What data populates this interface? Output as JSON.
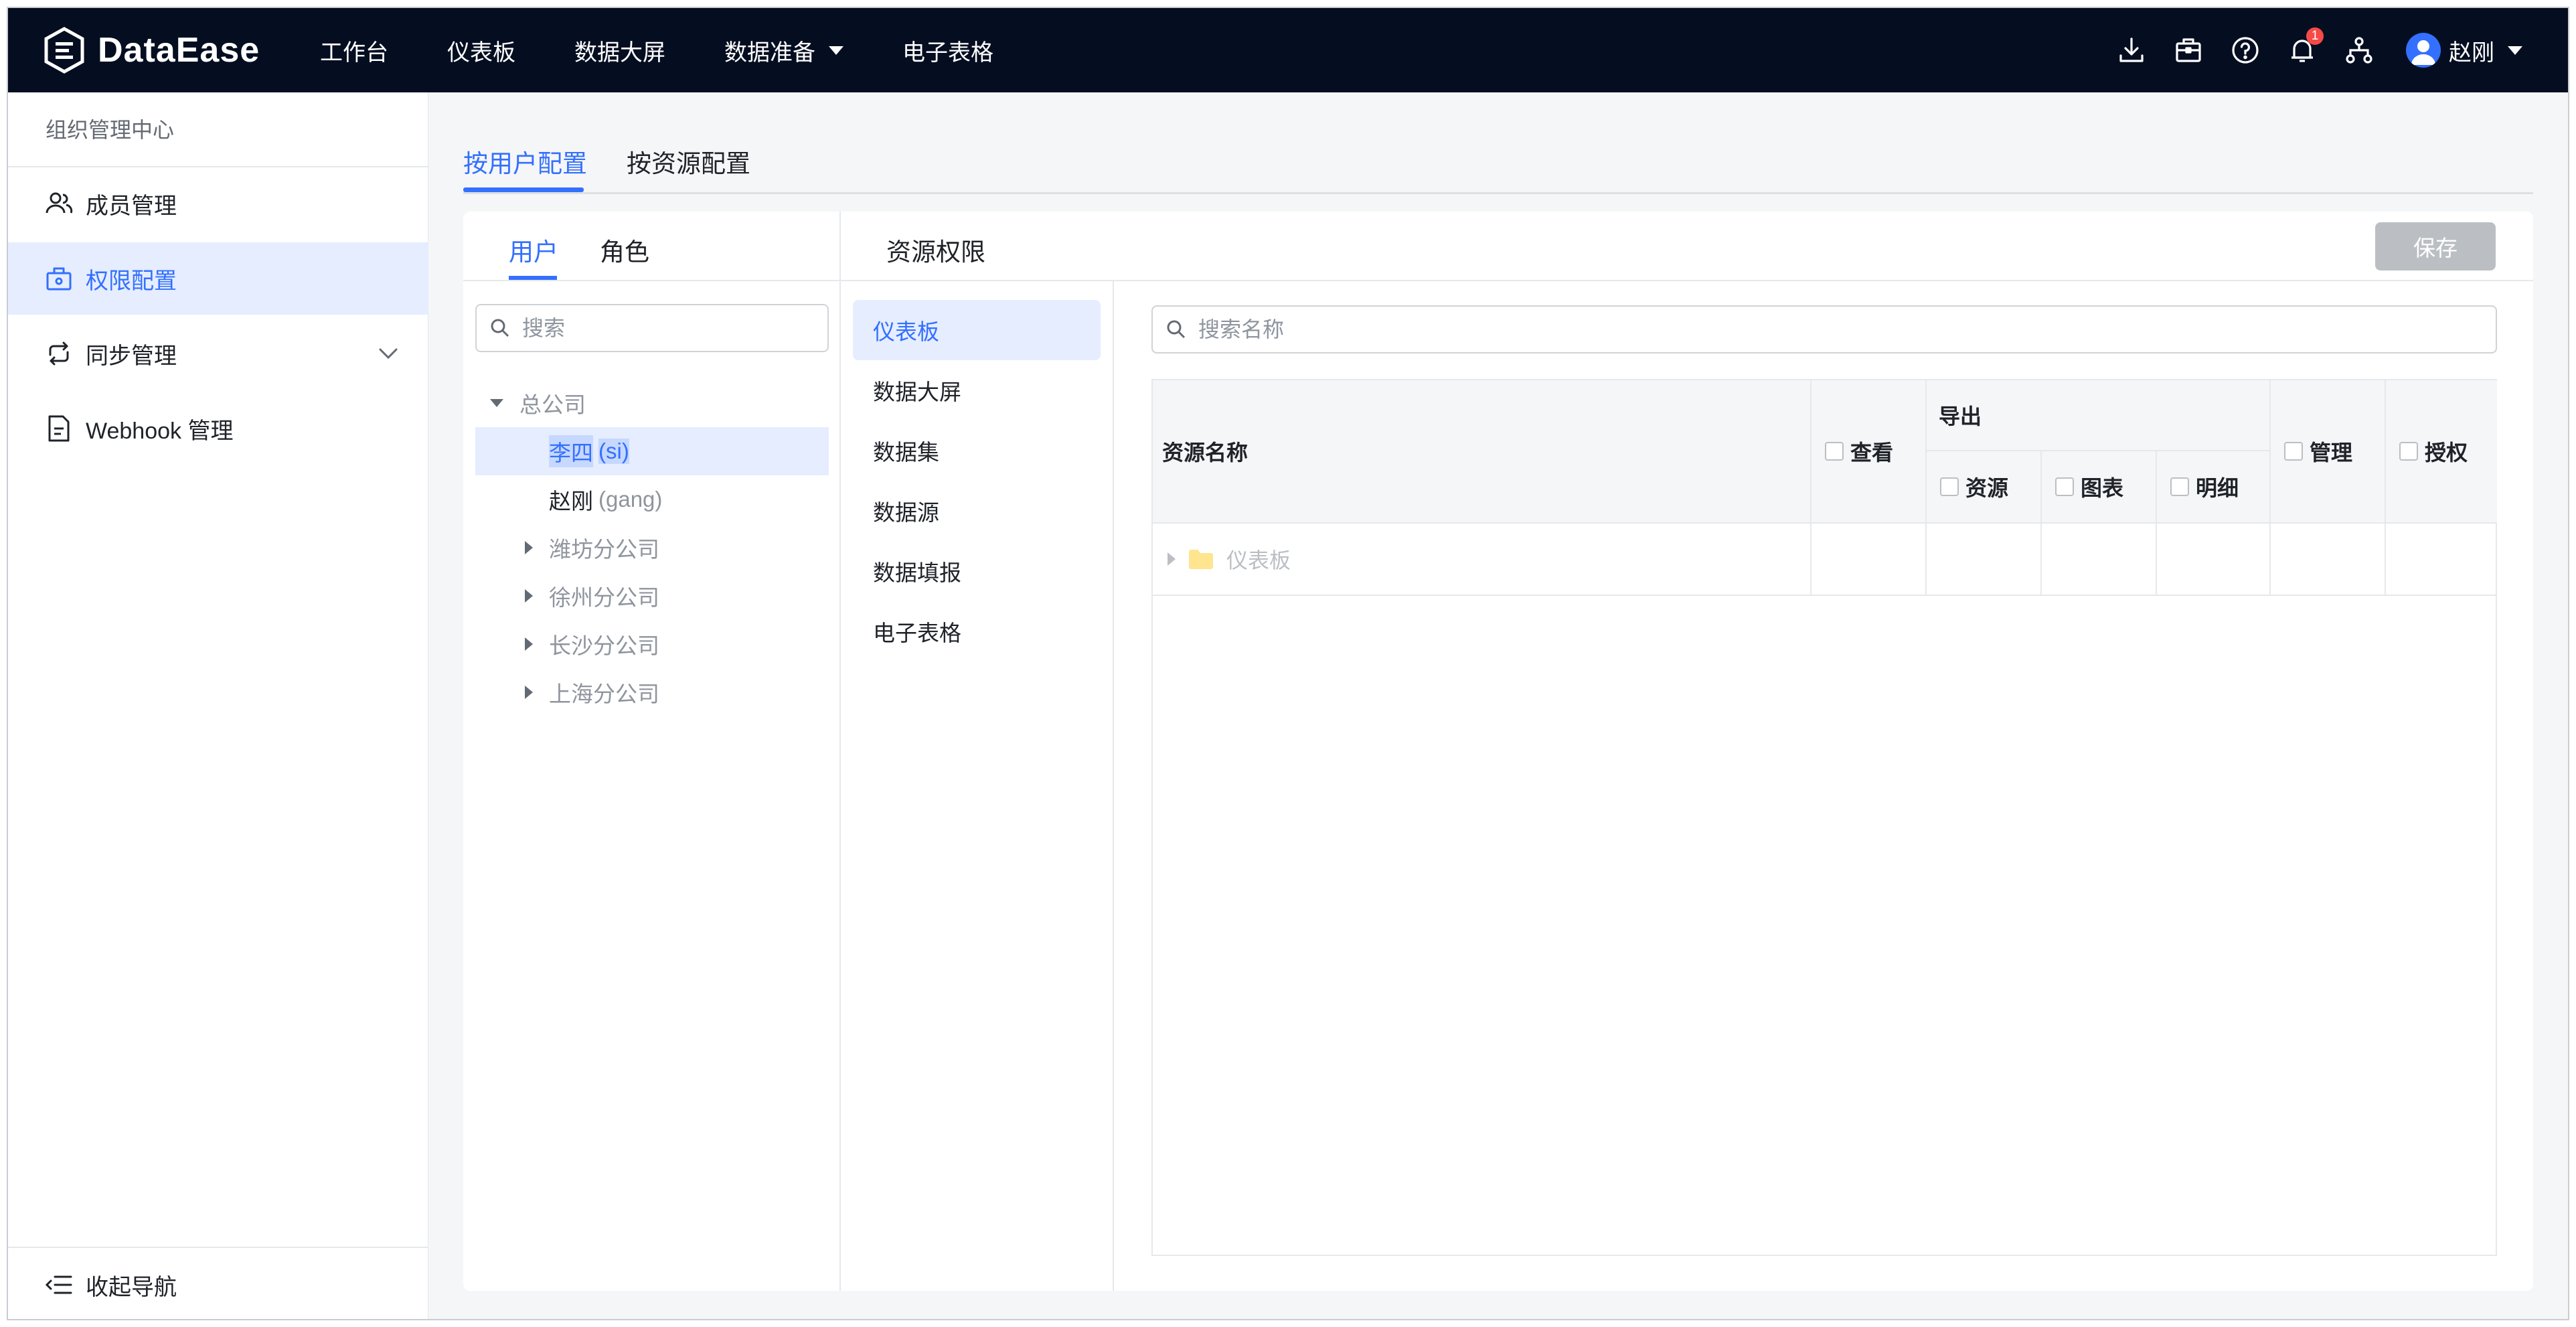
{
  "header": {
    "logo_text": "DataEase",
    "nav": [
      {
        "label": "工作台"
      },
      {
        "label": "仪表板"
      },
      {
        "label": "数据大屏"
      },
      {
        "label": "数据准备",
        "dropdown": true
      },
      {
        "label": "电子表格"
      }
    ],
    "icons": [
      "download-icon",
      "toolbox-icon",
      "help-icon",
      "bell-icon",
      "org-icon"
    ],
    "notification_count": "1",
    "user_name": "赵刚"
  },
  "sidebar": {
    "title": "组织管理中心",
    "items": [
      {
        "label": "成员管理",
        "icon": "members-icon"
      },
      {
        "label": "权限配置",
        "icon": "permission-icon",
        "active": true
      },
      {
        "label": "同步管理",
        "icon": "sync-icon",
        "expandable": true
      },
      {
        "label": "Webhook 管理",
        "icon": "webhook-icon"
      }
    ],
    "footer": "收起导航"
  },
  "main": {
    "tabs": [
      {
        "label": "按用户配置",
        "active": true
      },
      {
        "label": "按资源配置"
      }
    ],
    "users_panel": {
      "tabs": [
        {
          "label": "用户",
          "active": true
        },
        {
          "label": "角色"
        }
      ],
      "search_placeholder": "搜索",
      "tree": {
        "root": "总公司",
        "users": [
          {
            "name": "李四",
            "account": "(si)",
            "selected": true
          },
          {
            "name": "赵刚",
            "account": "(gang)"
          }
        ],
        "branches": [
          "潍坊分公司",
          "徐州分公司",
          "长沙分公司",
          "上海分公司"
        ]
      }
    },
    "resource_panel": {
      "title": "资源权限",
      "save_label": "保存",
      "menu": [
        "仪表板",
        "数据大屏",
        "数据集",
        "数据源",
        "数据填报",
        "电子表格"
      ],
      "active_menu": "仪表板",
      "search_placeholder": "搜索名称",
      "table": {
        "col_name": "资源名称",
        "col_view": "查看",
        "col_export": "导出",
        "export_sub": [
          "资源",
          "图表",
          "明细"
        ],
        "col_manage": "管理",
        "col_auth": "授权",
        "rows": [
          {
            "name": "仪表板"
          }
        ]
      }
    }
  },
  "colors": {
    "accent": "#3370ff",
    "header_bg": "#050e21",
    "active_bg": "#e5edff",
    "badge": "#f54a45",
    "folder": "#ffe58f"
  }
}
